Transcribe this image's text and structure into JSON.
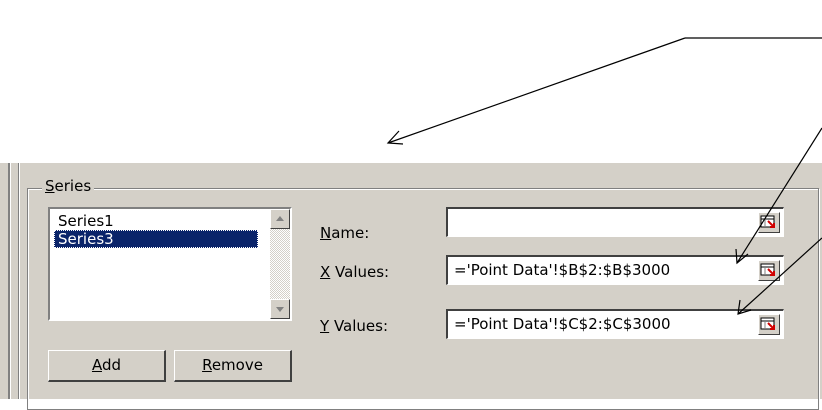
{
  "series_group": {
    "label": "Series",
    "accesskey": "S"
  },
  "series_list": {
    "items": [
      "Series1",
      "Series3"
    ],
    "selected_index": 1
  },
  "buttons": {
    "add": "Add",
    "remove": "Remove"
  },
  "fields": {
    "name": {
      "label": "Name:",
      "value": ""
    },
    "x_values": {
      "label": "X Values:",
      "value": "='Point Data'!$B$2:$B$3000"
    },
    "y_values": {
      "label": "Y Values:",
      "value": "='Point Data'!$C$2:$C$3000"
    }
  },
  "icons": {
    "range_button": "collapse-range-icon",
    "scroll_up": "scroll-up-icon",
    "scroll_down": "scroll-down-icon"
  },
  "colors": {
    "dialog_bg": "#d4d0c8",
    "selection_bg": "#0a246a",
    "field_bg": "#ffffff"
  }
}
